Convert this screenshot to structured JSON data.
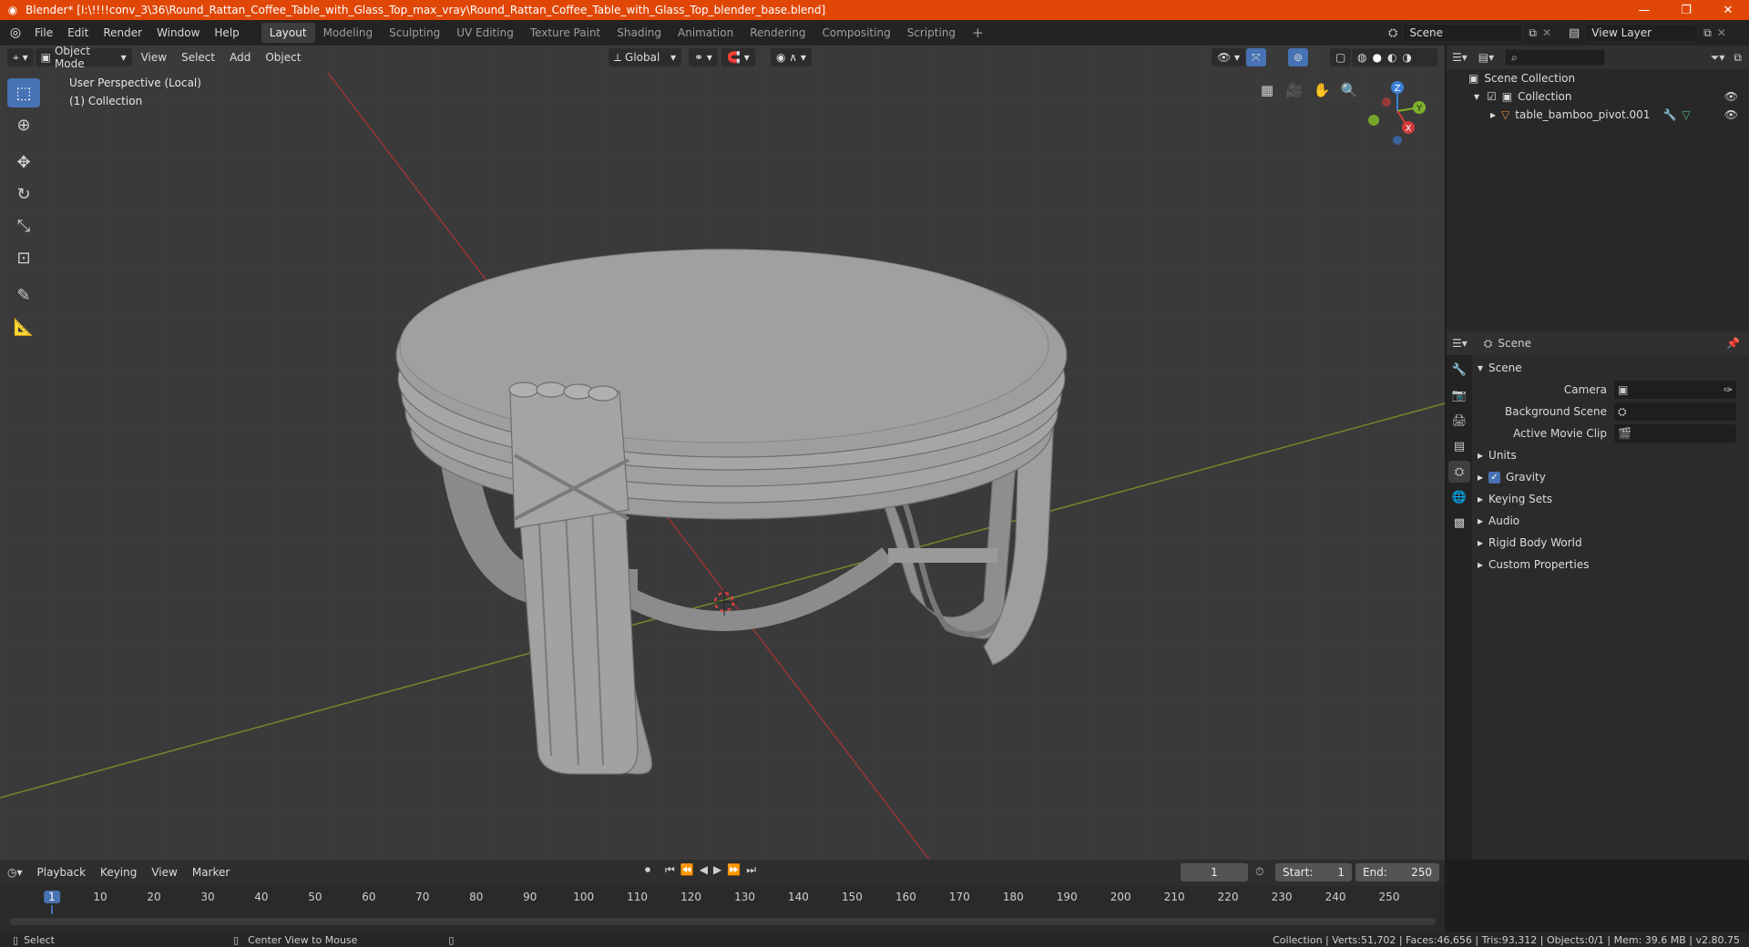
{
  "window": {
    "title": "Blender* [I:\\!!!!conv_3\\36\\Round_Rattan_Coffee_Table_with_Glass_Top_max_vray\\Round_Rattan_Coffee_Table_with_Glass_Top_blender_base.blend]",
    "minimize": "—",
    "maximize": "❐",
    "close": "✕"
  },
  "menu": [
    "File",
    "Edit",
    "Render",
    "Window",
    "Help"
  ],
  "workspaces": [
    "Layout",
    "Modeling",
    "Sculpting",
    "UV Editing",
    "Texture Paint",
    "Shading",
    "Animation",
    "Rendering",
    "Compositing",
    "Scripting"
  ],
  "workspace_add": "+",
  "scene_field": "Scene",
  "view_layer_field": "View Layer",
  "viewport": {
    "mode": "Object Mode",
    "menus": [
      "View",
      "Select",
      "Add",
      "Object"
    ],
    "transform_orientation": "Global",
    "perspective_label": "User Perspective (Local)",
    "collection_label": "(1) Collection",
    "gizmo": {
      "x": "X",
      "y": "Y",
      "z": "Z"
    }
  },
  "outliner": {
    "scene_collection": "Scene Collection",
    "collection": "Collection",
    "object": "table_bamboo_pivot.001"
  },
  "properties": {
    "header_title": "Scene",
    "panel_title": "Scene",
    "camera_label": "Camera",
    "background_scene_label": "Background Scene",
    "active_movie_clip_label": "Active Movie Clip",
    "sections": [
      "Units",
      "Gravity",
      "Keying Sets",
      "Audio",
      "Rigid Body World",
      "Custom Properties"
    ],
    "gravity_checked": true
  },
  "timeline": {
    "menus": [
      "Playback",
      "Keying",
      "View",
      "Marker"
    ],
    "current_frame": "1",
    "start_label": "Start:",
    "start": "1",
    "end_label": "End:",
    "end": "250",
    "ruler": [
      "1",
      "10",
      "20",
      "30",
      "40",
      "50",
      "60",
      "70",
      "80",
      "90",
      "100",
      "110",
      "120",
      "130",
      "140",
      "150",
      "160",
      "170",
      "180",
      "190",
      "200",
      "210",
      "220",
      "230",
      "240",
      "250"
    ]
  },
  "status": {
    "left_action": "Select",
    "middle_action": "Center View to Mouse",
    "stats": "Collection | Verts:51,702 | Faces:46,656 | Tris:93,312 | Objects:0/1 | Mem: 39.6 MB | v2.80.75"
  },
  "colors": {
    "titlebar": "#e04707",
    "accent": "#4772b3",
    "x_axis": "#d23a3a",
    "y_axis": "#7fb22a",
    "z_axis": "#3c7fd8"
  }
}
